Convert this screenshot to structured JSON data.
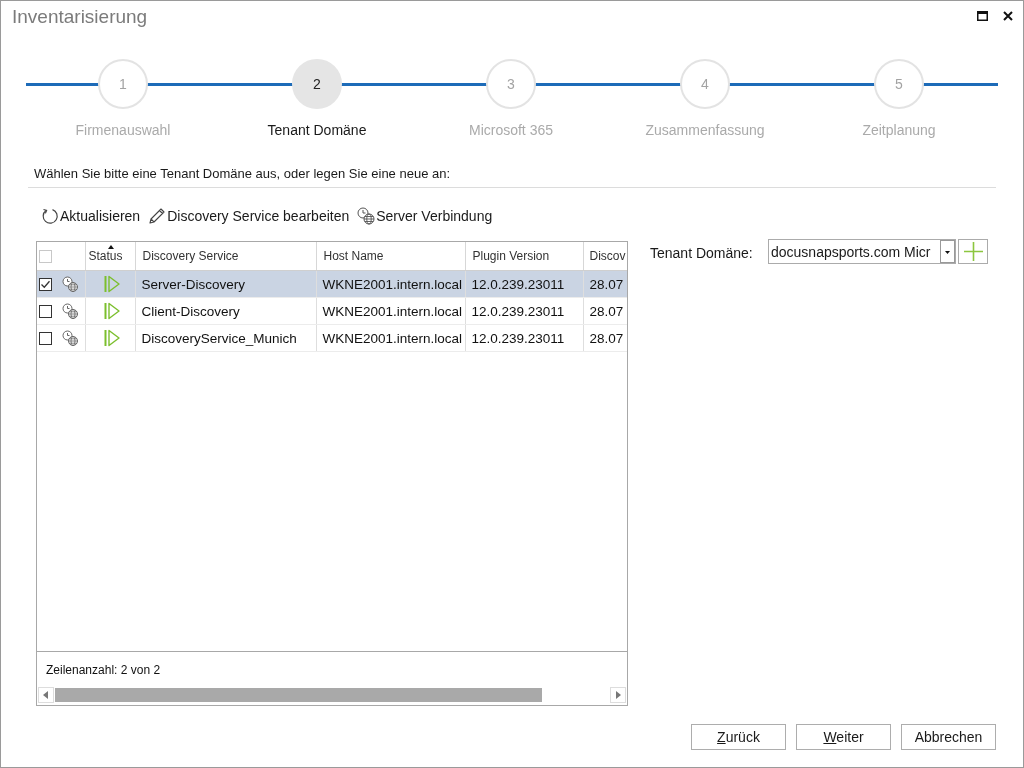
{
  "window": {
    "title": "Inventarisierung"
  },
  "steps": [
    {
      "number": "1",
      "label": "Firmenauswahl",
      "selected": false
    },
    {
      "number": "2",
      "label": "Tenant Domäne",
      "selected": true
    },
    {
      "number": "3",
      "label": "Microsoft 365",
      "selected": false
    },
    {
      "number": "4",
      "label": "Zusammenfassung",
      "selected": false
    },
    {
      "number": "5",
      "label": "Zeitplanung",
      "selected": false
    }
  ],
  "instruction": "Wählen Sie bitte eine Tenant Domäne aus, oder legen Sie eine neue an:",
  "toolbar": [
    {
      "kind": "refresh",
      "label": "Aktualisieren"
    },
    {
      "kind": "edit",
      "label": "Discovery Service bearbeiten"
    },
    {
      "kind": "connection",
      "label": "Server Verbindung"
    }
  ],
  "table": {
    "select_all_checked": false,
    "columns": [
      {
        "label": "Status",
        "sorted": true
      },
      {
        "label": "Discovery Service",
        "sorted": false
      },
      {
        "label": "Host Name",
        "sorted": false
      },
      {
        "label": "Plugin Version",
        "sorted": false
      },
      {
        "label": "Discov",
        "sorted": false
      }
    ],
    "rows": [
      {
        "checked": true,
        "selected": true,
        "discovery_service": "Server-Discovery",
        "host_name": "WKNE2001.intern.local",
        "plugin_version": "12.0.239.23011",
        "column_6": "28.07"
      },
      {
        "checked": false,
        "selected": false,
        "discovery_service": "Client-Discovery",
        "host_name": "WKNE2001.intern.local",
        "plugin_version": "12.0.239.23011",
        "column_6": "28.07"
      },
      {
        "checked": false,
        "selected": false,
        "discovery_service": "DiscoveryService_Munich",
        "host_name": "WKNE2001.intern.local",
        "plugin_version": "12.0.239.23011",
        "column_6": "28.07"
      }
    ],
    "row_count": "Zeilenanzahl: 2 von 2"
  },
  "tenant_domain": {
    "label": "Tenant Domäne:",
    "value": "docusnapsports.com Micr"
  },
  "buttons": [
    {
      "label": "Zurück",
      "mnemonic_underlined": true
    },
    {
      "label": "Weiter",
      "mnemonic_underlined": true
    },
    {
      "label": "Abbrechen",
      "mnemonic_underlined": false
    }
  ]
}
